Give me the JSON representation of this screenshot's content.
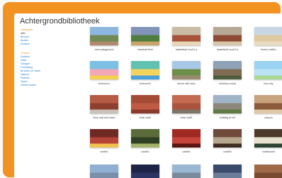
{
  "window": {
    "title": "Achtergrondbibliotheek"
  },
  "sidebar": {
    "category_heading": "Categorie",
    "categories": [
      "Alle",
      "Binnen",
      "Buiten",
      "Andere"
    ],
    "theme_heading": "Thema",
    "themes": [
      "Kasteel",
      "Stad",
      "Vliegen",
      "Feestdag",
      "Muziek en dans",
      "Natuur",
      "Ruimte",
      "Sport",
      "Onder water"
    ]
  },
  "backdrops": [
    {
      "label": "atom playground",
      "colors": [
        "#8db7e0",
        "#6f8a55",
        "#b08a6e"
      ]
    },
    {
      "label": "baseball-field",
      "colors": [
        "#7f94b8",
        "#4f7d3d",
        "#c9a46b"
      ]
    },
    {
      "label": "basketball-court1-a",
      "colors": [
        "#c9bba4",
        "#a8523a",
        "#e8d7b4"
      ]
    },
    {
      "label": "basketball-court1-b",
      "colors": [
        "#b6a894",
        "#8e4a35",
        "#d7c7a8"
      ]
    },
    {
      "label": "beach malibu",
      "colors": [
        "#c9d6e3",
        "#dfc9a1",
        "#e8dcc4"
      ]
    },
    {
      "label": "bedroom1",
      "colors": [
        "#7cc0e6",
        "#f2a8b8",
        "#f3d04e"
      ]
    },
    {
      "label": "bedroom2",
      "colors": [
        "#62c2b0",
        "#f2d35b",
        "#4aa0d8"
      ]
    },
    {
      "label": "bench with view",
      "colors": [
        "#a9c7e6",
        "#6e8f4a",
        "#9b8a72"
      ]
    },
    {
      "label": "berkeley mural",
      "colors": [
        "#8fa1b6",
        "#7f6a52",
        "#4e5d3c"
      ]
    },
    {
      "label": "blue sky",
      "colors": [
        "#9ad2f2",
        "#b9e2f4",
        "#a8d890"
      ]
    },
    {
      "label": "brick wall and stairs",
      "colors": [
        "#b65b43",
        "#8e3f2f",
        "#c8c2b8"
      ]
    },
    {
      "label": "brick wall1",
      "colors": [
        "#a44b36",
        "#c05a42",
        "#8a3a2a"
      ]
    },
    {
      "label": "brick wall2",
      "colors": [
        "#c46a50",
        "#ab5540",
        "#7e7468"
      ]
    },
    {
      "label": "building at mit",
      "colors": [
        "#a0b4c8",
        "#8d877a",
        "#5f7a42"
      ]
    },
    {
      "label": "canyon",
      "colors": [
        "#c8a27c",
        "#8b5a3a",
        "#e0c8a8"
      ]
    },
    {
      "label": "castle1",
      "colors": [
        "#6e2a22",
        "#b4443a",
        "#f2c14e"
      ]
    },
    {
      "label": "castle2",
      "colors": [
        "#5c6b3a",
        "#2f3f22",
        "#a3b36a"
      ]
    },
    {
      "label": "castle4",
      "colors": [
        "#9f2a24",
        "#c7443a",
        "#5a1510"
      ]
    },
    {
      "label": "castle5",
      "colors": [
        "#6f4a3a",
        "#b7a78e",
        "#3e2c22"
      ]
    },
    {
      "label": "chalkboard",
      "colors": [
        "#4c3a2c",
        "#e8e2d0",
        "#2c4232"
      ]
    },
    {
      "label": "",
      "colors": [
        "#8fb0d2",
        "#7a8fa8",
        "#aac0d8"
      ]
    },
    {
      "label": "",
      "colors": [
        "#1d2447",
        "#2b3563",
        "#5a3a6a"
      ]
    },
    {
      "label": "",
      "colors": [
        "#9ab8d4",
        "#7a8a9a",
        "#c0cedc"
      ]
    },
    {
      "label": "",
      "colors": [
        "#3a4a6a",
        "#6a7e9a",
        "#2b3350"
      ]
    },
    {
      "label": "",
      "colors": [
        "#a06a4a",
        "#7a4a30",
        "#c89a6a"
      ]
    }
  ]
}
